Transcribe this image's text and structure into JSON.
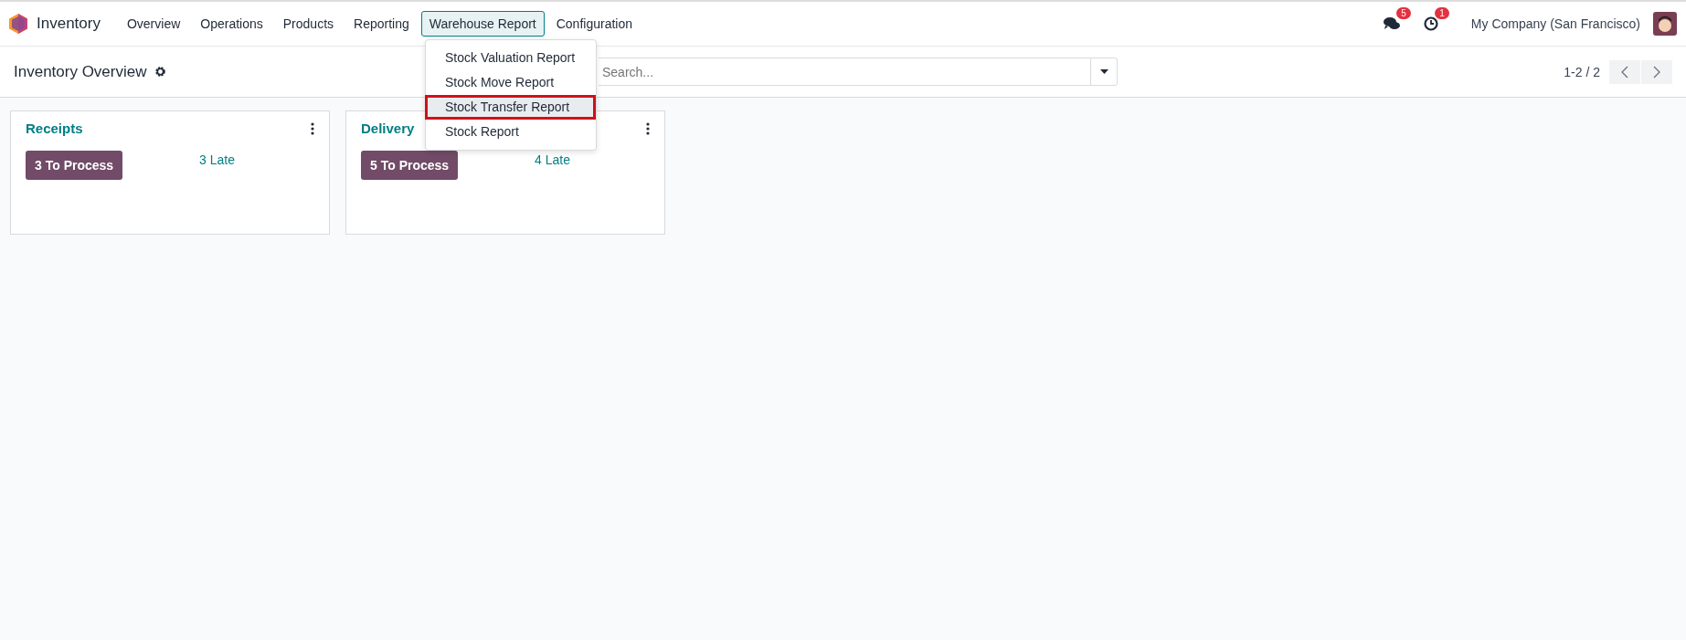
{
  "navbar": {
    "app_name": "Inventory",
    "menus": [
      {
        "label": "Overview",
        "selected": false
      },
      {
        "label": "Operations",
        "selected": false
      },
      {
        "label": "Products",
        "selected": false
      },
      {
        "label": "Reporting",
        "selected": false
      },
      {
        "label": "Warehouse Report",
        "selected": true
      },
      {
        "label": "Configuration",
        "selected": false
      }
    ],
    "messages_count": "5",
    "activities_count": "1",
    "company": "My Company (San Francisco)"
  },
  "dropdown": {
    "items": [
      {
        "label": "Stock Valuation Report",
        "selected": false
      },
      {
        "label": "Stock Move Report",
        "selected": false
      },
      {
        "label": "Stock Transfer Report",
        "selected": true
      },
      {
        "label": "Stock Report",
        "selected": false
      }
    ]
  },
  "control_panel": {
    "title": "Inventory Overview",
    "search": {
      "placeholder": "Search..."
    },
    "pager": "1-2 / 2"
  },
  "cards": [
    {
      "title": "Receipts",
      "button": "3 To Process",
      "late": "3 Late"
    },
    {
      "title": "Delivery",
      "button": "5 To Process",
      "late": "4 Late"
    }
  ]
}
